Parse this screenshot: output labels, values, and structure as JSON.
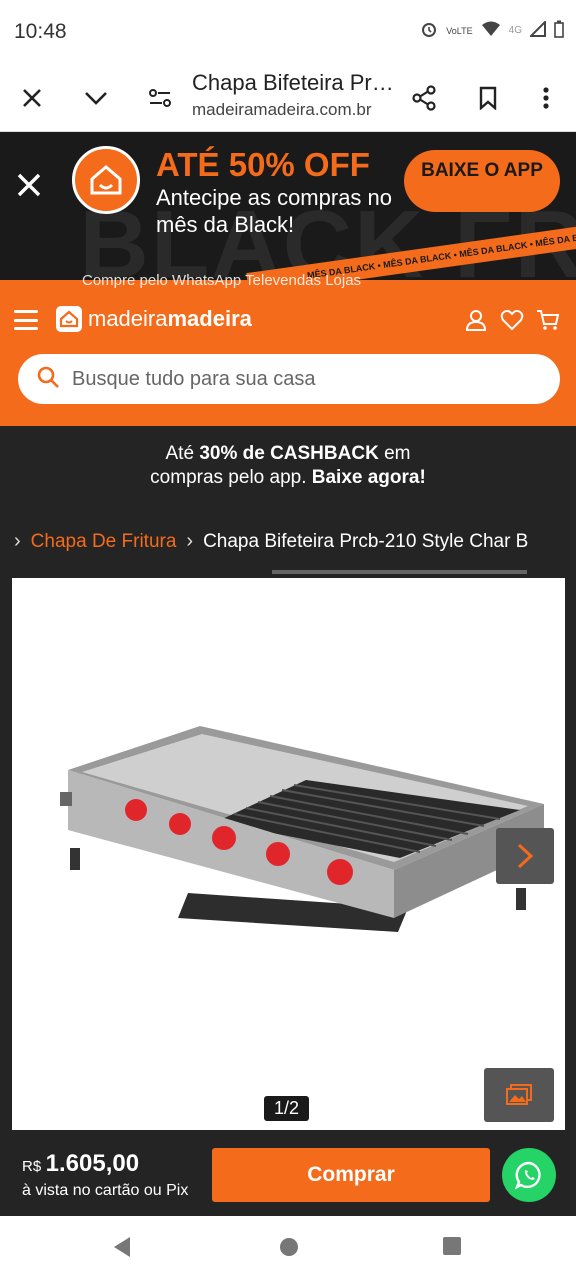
{
  "status_bar": {
    "time": "10:48",
    "net_label": "4G",
    "volte_label": "VoLTE"
  },
  "browser": {
    "page_title": "Chapa Bifeteira Prcb-210 Style Char B",
    "url": "madeiramadeira.com.br",
    "icons": [
      "close-icon",
      "chevron-down-icon",
      "site-settings-icon",
      "share-icon",
      "bookmark-icon",
      "more-icon"
    ]
  },
  "promo": {
    "headline": "ATÉ 50% OFF",
    "subtext": "Antecipe as compras no mês da Black!",
    "app_button": "BAIXE O APP",
    "ribbon_text": "MÊS DA BLACK  •  MÊS DA BLACK  •  MÊS DA BLACK  •  MÊS DA BLACK",
    "bg_text": "BLACK FR"
  },
  "header": {
    "ghost_text": "Compre pelo  WhatsApp   Televendas   Lojas",
    "brand_light": "madeira",
    "brand_bold": "madeira",
    "search_placeholder": "Busque tudo para sua casa"
  },
  "cashback": {
    "line1_pre": "Até ",
    "line1_bold": "30% de CASHBACK",
    "line1_post": " em",
    "line2_pre": "compras pelo app. ",
    "line2_bold": "Baixe agora!"
  },
  "breadcrumb": {
    "items": [
      {
        "label": "Chapa De Fritura"
      },
      {
        "label": "Chapa Bifeteira Prcb-210 Style Char B"
      }
    ]
  },
  "gallery": {
    "page_indicator": "1/2"
  },
  "buy_bar": {
    "currency": "R$",
    "price": "1.605,00",
    "price_note": "à vista no cartão ou Pix",
    "buy_label": "Comprar"
  },
  "colors": {
    "accent": "#f36b1b",
    "dark": "#242424",
    "whatsapp": "#25d366"
  }
}
